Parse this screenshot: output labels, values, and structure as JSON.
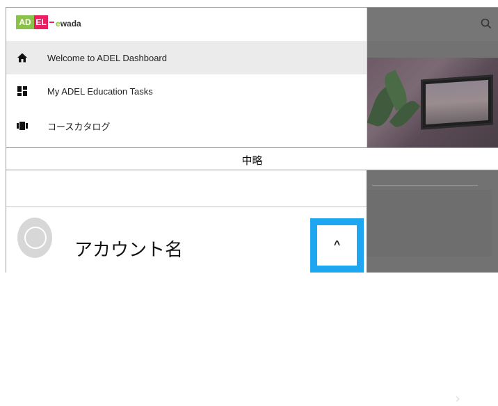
{
  "logo": {
    "mark_left": "AD",
    "mark_right": "EL",
    "wordmark_prefix": "e",
    "wordmark": "wada"
  },
  "nav": {
    "items": [
      {
        "label": "Welcome to ADEL Dashboard",
        "icon": "home-icon",
        "active": true
      },
      {
        "label": "My ADEL Education Tasks",
        "icon": "dashboard-icon",
        "active": false
      },
      {
        "label": "コースカタログ",
        "icon": "catalog-icon",
        "active": false
      }
    ]
  },
  "band": {
    "label": "中略"
  },
  "account": {
    "name": "アカウント名",
    "toggle_symbol": "^"
  },
  "dashboard": {
    "chevron": "›"
  },
  "colors": {
    "accent": "#1ea7f0",
    "overlay": "#727272",
    "active_bg": "#ebebeb"
  }
}
